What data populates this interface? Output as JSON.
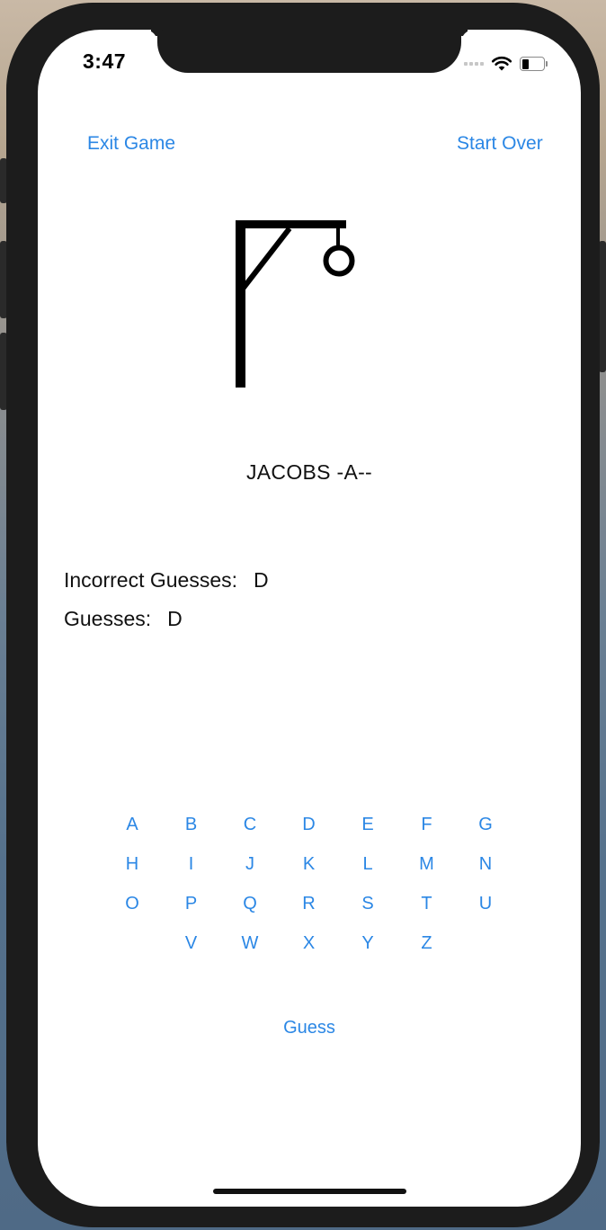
{
  "status_bar": {
    "time": "3:47"
  },
  "nav": {
    "exit_label": "Exit Game",
    "start_over_label": "Start Over"
  },
  "game": {
    "word_display": "JACOBS -A--",
    "incorrect_label": "Incorrect Guesses:",
    "incorrect_value": "D",
    "guesses_label": "Guesses:",
    "guesses_value": "D"
  },
  "keyboard": {
    "rows": [
      [
        "A",
        "B",
        "C",
        "D",
        "E",
        "F",
        "G"
      ],
      [
        "H",
        "I",
        "J",
        "K",
        "L",
        "M",
        "N"
      ],
      [
        "O",
        "P",
        "Q",
        "R",
        "S",
        "T",
        "U"
      ],
      [
        "V",
        "W",
        "X",
        "Y",
        "Z"
      ]
    ]
  },
  "actions": {
    "guess_label": "Guess"
  },
  "colors": {
    "accent": "#2b87e5",
    "text": "#111111",
    "frame": "#1c1c1c"
  },
  "icons": {
    "wifi": "wifi-icon",
    "battery": "battery-icon",
    "signal": "cellular-signal-icon"
  }
}
